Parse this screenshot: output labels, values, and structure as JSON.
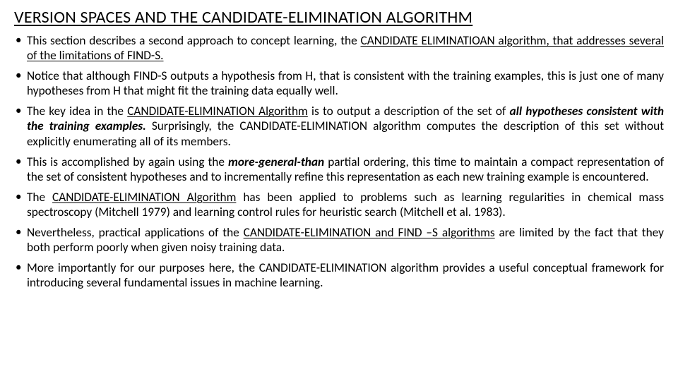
{
  "title": "VERSION SPACES AND THE CANDIDATE-ELIMINATION ALGORITHM",
  "bullets": [
    {
      "pre": "This section describes a second approach to concept learning, the ",
      "u1": "CANDIDATE ELIMINATIOAN algorithm, that addresses several of the limitations of FIND-S.",
      "post": ""
    },
    {
      "plain": "Notice that although FIND-S outputs a hypothesis from H, that is consistent with the training examples, this is just one of many hypotheses from H that might fit the training data equally well."
    },
    {
      "pre": "The key idea in the ",
      "u1": "CANDIDATE-ELIMINATION Algorithm",
      "mid1": " is to output a description of the set of ",
      "bi1": "all hypotheses consistent with the training examples.",
      "mid2": " Surprisingly, the CANDIDATE-ELIMINATION algorithm computes the description of this set without explicitly enumerating all of its members."
    },
    {
      "pre": "This is accomplished by again using the ",
      "bi1": "more-general-than",
      "post": " partial ordering, this time to maintain a compact representation of the set of consistent hypotheses and to incrementally refine this representation as each new training example is encountered."
    },
    {
      "pre": "The ",
      "u1": "CANDIDATE-ELIMINATION Algorithm",
      "post": " has been applied to problems such as learning regularities in chemical mass spectroscopy (Mitchell 1979) and learning control rules for heuristic search (Mitchell et al. 1983)."
    },
    {
      "pre": "Nevertheless, practical applications of the ",
      "u1": "CANDIDATE-ELIMINATION and FIND –S algorithms",
      "post": " are limited by the fact that they both perform poorly when given noisy training data."
    },
    {
      "plain": "More importantly for our purposes here, the CANDIDATE-ELIMINATION algorithm provides a useful conceptual framework for introducing several fundamental issues in machine learning."
    }
  ]
}
